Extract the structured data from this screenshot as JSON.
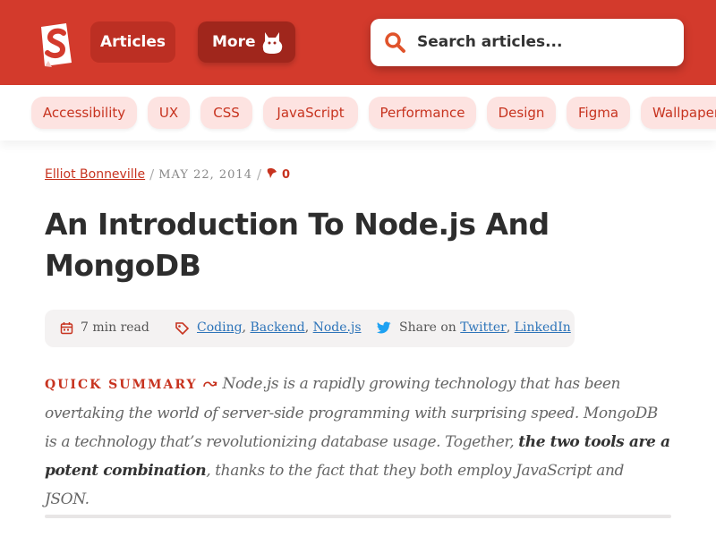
{
  "header": {
    "logo_letter": "S",
    "nav": {
      "articles": "Articles",
      "more": "More"
    },
    "search_placeholder": "Search articles..."
  },
  "tags": [
    "Accessibility",
    "UX",
    "CSS",
    "JavaScript",
    "Performance",
    "Design",
    "Figma",
    "Wallpapers"
  ],
  "article": {
    "author": "Elliot Bonneville",
    "date": "MAY 22, 2014",
    "comment_count": "0",
    "title": "An Introduction To Node.js And MongoDB",
    "read_time": "7 min read",
    "categories": [
      "Coding",
      "Backend",
      "Node.js"
    ],
    "share_label": "Share on",
    "share_links": [
      "Twitter",
      "LinkedIn"
    ],
    "summary_label": "QUICK SUMMARY",
    "summary_text_1": "Node.js is a rapidly growing technology that has been overtaking the world of server-side programming with surprising speed. MongoDB is a technology that’s revolutionizing database usage. Together,",
    "summary_bold": "the two tools are a potent combination",
    "summary_text_2": ", thanks to the fact that they both employ JavaScript and JSON."
  },
  "colors": {
    "brand_red": "#d33a2c",
    "tag_bg": "#fde3e1",
    "link_blue": "#2d74b9"
  }
}
